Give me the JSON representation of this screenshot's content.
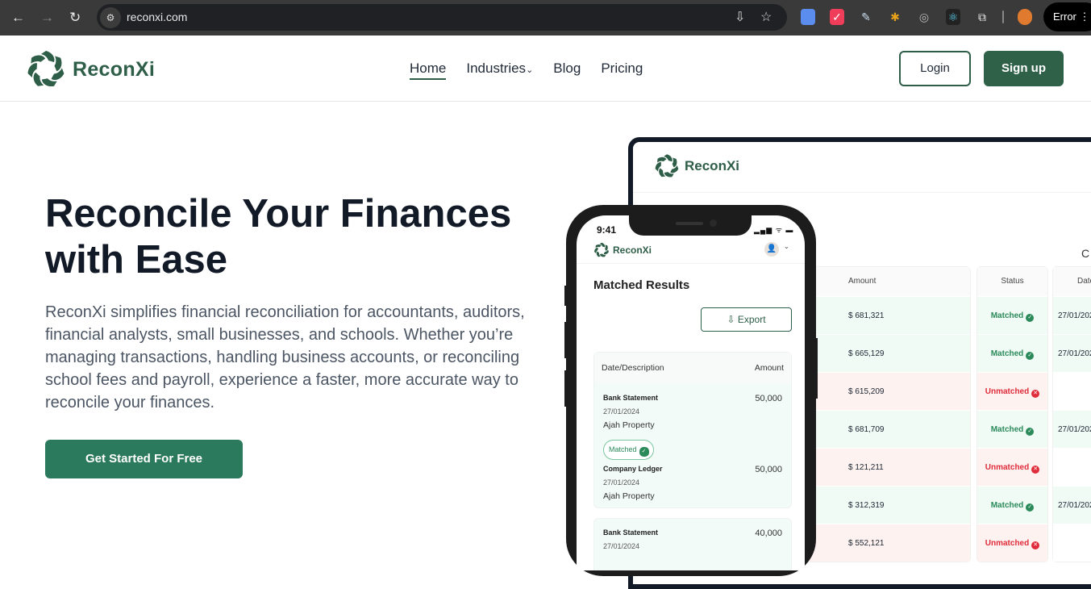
{
  "browser": {
    "url": "reconxi.com",
    "error_label": "Error",
    "extensions": [
      "docs-icon",
      "calendar-icon",
      "eyedropper-icon",
      "bug-icon",
      "target-icon",
      "react-icon",
      "puzzle-icon"
    ]
  },
  "nav": {
    "brand": "ReconXi",
    "items": [
      {
        "label": "Home",
        "active": true
      },
      {
        "label": "Industries"
      },
      {
        "label": "Blog"
      },
      {
        "label": "Pricing"
      }
    ],
    "login": "Login",
    "signup": "Sign up",
    "brand_color": "#2e5e48"
  },
  "hero": {
    "title": "Reconcile Your Finances with Ease",
    "description": "ReconXi simplifies financial reconciliation for accountants, auditors, financial analysts, small businesses, and schools. Whether you’re managing transactions, handling business accounts, or reconciling school fees and payroll, experience a faster, more accurate way to reconcile your finances.",
    "cta": "Get Started For Free",
    "cta_color": "#2c7a5e"
  },
  "laptop": {
    "brand": "ReconXi",
    "heading_fragment": "C",
    "columns": {
      "amount": "Amount",
      "status": "Status",
      "date": "Date"
    },
    "rows": [
      {
        "amount": "$ 681,321",
        "status": "Matched",
        "date": "27/01/202"
      },
      {
        "amount": "$ 665,129",
        "status": "Matched",
        "date": "27/01/202"
      },
      {
        "amount": "$ 615,209",
        "status": "Unmatched",
        "date": ""
      },
      {
        "amount": "$ 681,709",
        "status": "Matched",
        "date": "27/01/202"
      },
      {
        "amount": "$ 121,211",
        "status": "Unmatched",
        "date": ""
      },
      {
        "amount": "$ 312,319",
        "status": "Matched",
        "date": "27/01/202"
      },
      {
        "amount": "$ 552,121",
        "status": "Unmatched",
        "date": ""
      }
    ]
  },
  "phone": {
    "time": "9:41",
    "brand": "ReconXi",
    "title": "Matched Results",
    "export": "Export",
    "card_headers": {
      "description": "Date/Description",
      "amount": "Amount"
    },
    "entries": [
      {
        "source": "Bank Statement",
        "date": "27/01/2024",
        "party": "Ajah Property",
        "amount": "50,000"
      },
      {
        "source": "Company Ledger",
        "date": "27/01/2024",
        "party": "Ajah Property",
        "amount": "50,000"
      },
      {
        "source": "Bank Statement",
        "date": "27/01/2024",
        "amount": "40,000"
      }
    ],
    "match_badge": "Matched"
  }
}
